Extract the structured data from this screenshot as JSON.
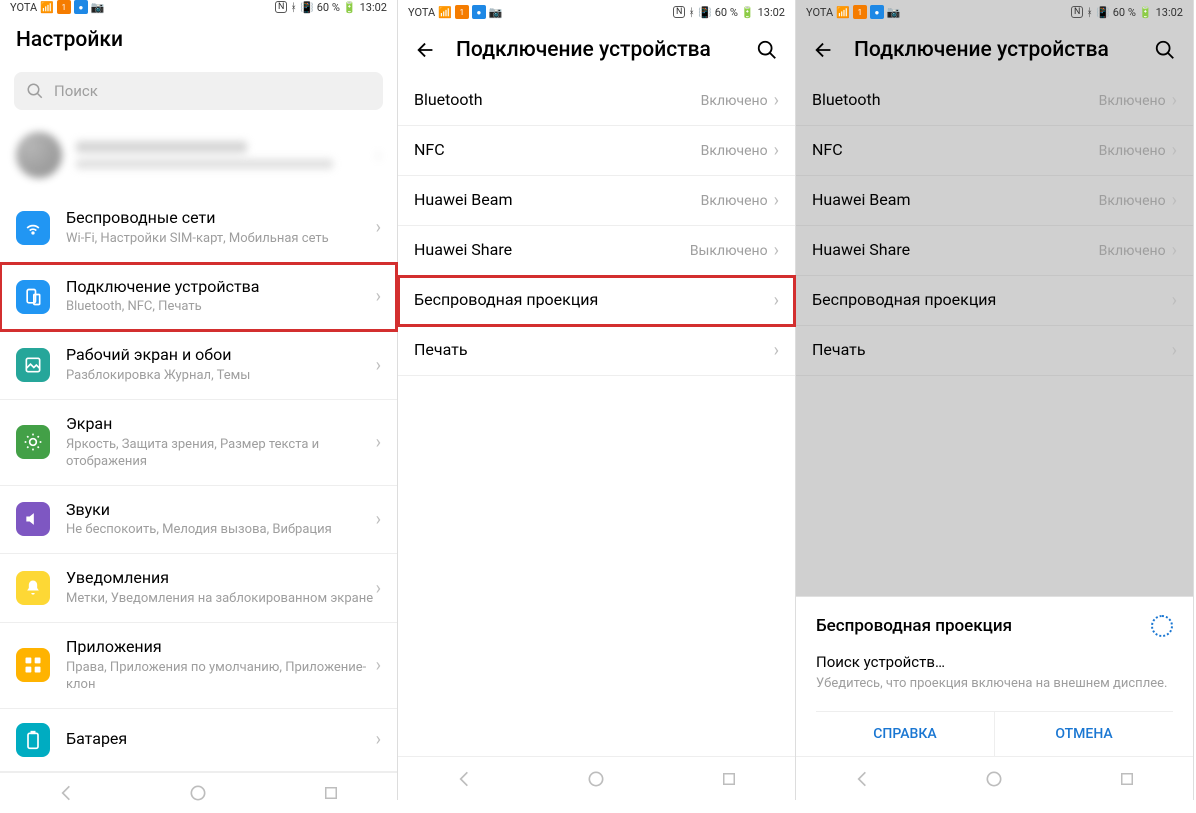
{
  "status": {
    "carrier": "YOTA",
    "nfc": "N",
    "bt": "60 %",
    "time": "13:02"
  },
  "screen1": {
    "title": "Настройки",
    "search_placeholder": "Поиск",
    "items": [
      {
        "title": "Беспроводные сети",
        "sub": "Wi-Fi, Настройки SIM-карт, Мобильная сеть"
      },
      {
        "title": "Подключение устройства",
        "sub": "Bluetooth, NFC, Печать"
      },
      {
        "title": "Рабочий экран и обои",
        "sub": "Разблокировка Журнал, Темы"
      },
      {
        "title": "Экран",
        "sub": "Яркость, Защита зрения, Размер текста и отображения"
      },
      {
        "title": "Звуки",
        "sub": "Не беспокоить, Мелодия вызова, Вибрация"
      },
      {
        "title": "Уведомления",
        "sub": "Метки, Уведомления на заблокированном экране"
      },
      {
        "title": "Приложения",
        "sub": "Права, Приложения по умолчанию, Приложение-клон"
      },
      {
        "title": "Батарея",
        "sub": ""
      }
    ]
  },
  "screen2": {
    "title": "Подключение устройства",
    "items": [
      {
        "title": "Bluetooth",
        "value": "Включено"
      },
      {
        "title": "NFC",
        "value": "Включено"
      },
      {
        "title": "Huawei Beam",
        "value": "Включено"
      },
      {
        "title": "Huawei Share",
        "value": "Выключено"
      },
      {
        "title": "Беспроводная проекция",
        "value": ""
      },
      {
        "title": "Печать",
        "value": ""
      }
    ]
  },
  "screen3": {
    "title": "Подключение устройства",
    "items": [
      {
        "title": "Bluetooth",
        "value": "Включено"
      },
      {
        "title": "NFC",
        "value": "Включено"
      },
      {
        "title": "Huawei Beam",
        "value": "Включено"
      },
      {
        "title": "Huawei Share",
        "value": "Включено"
      },
      {
        "title": "Беспроводная проекция",
        "value": ""
      },
      {
        "title": "Печать",
        "value": ""
      }
    ],
    "dialog": {
      "title": "Беспроводная проекция",
      "searching": "Поиск устройств…",
      "help": "Убедитесь, что проекция включена на внешнем дисплее.",
      "btn_help": "СПРАВКА",
      "btn_cancel": "ОТМЕНА"
    }
  }
}
